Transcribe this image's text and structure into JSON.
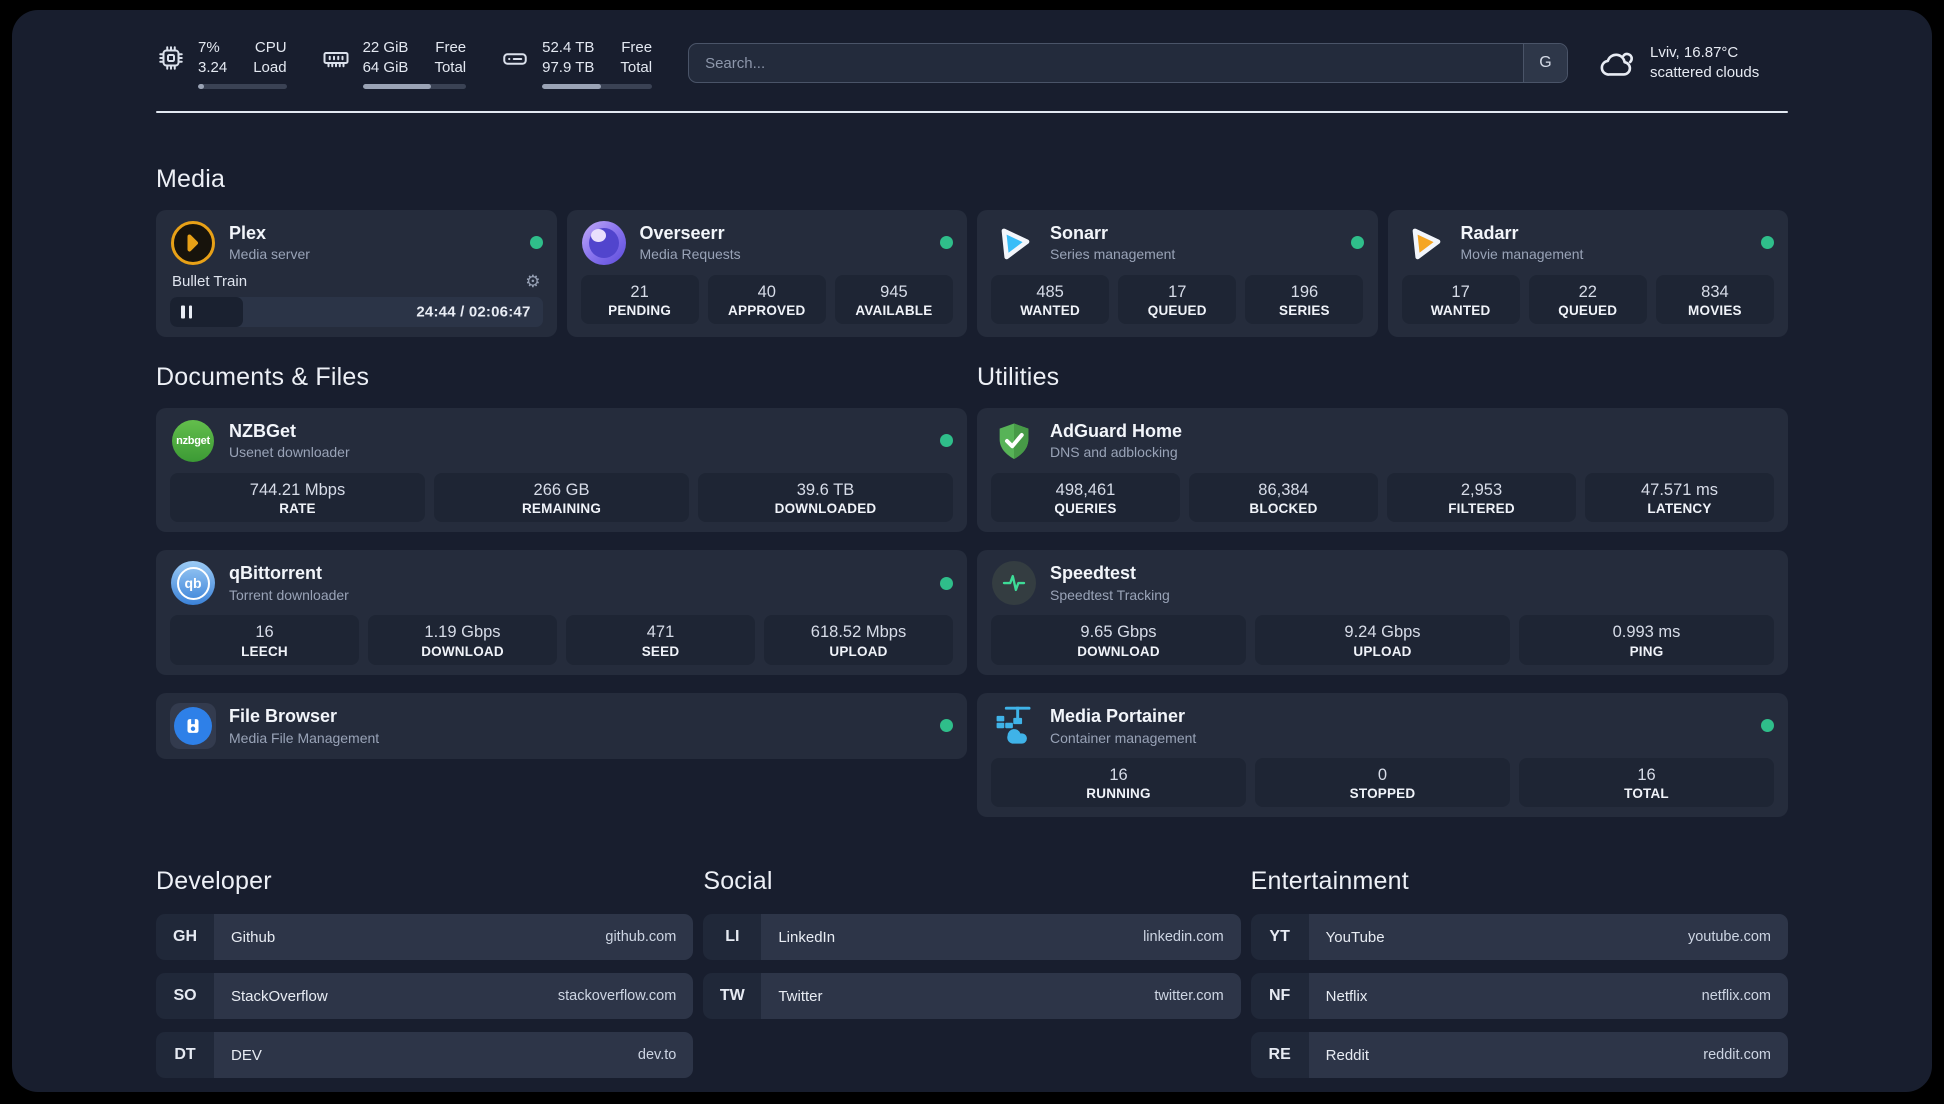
{
  "theme": {
    "background": "#181E2E",
    "card": "#252C3C",
    "tile": "#1E2534",
    "status_green": "#2FBE8A",
    "divider": "#E2E8F1"
  },
  "header": {
    "stats": [
      {
        "icon": "cpu-icon",
        "value_top": "7%",
        "value_bottom": "3.24",
        "label_top": "CPU",
        "label_bottom": "Load",
        "progress_pct": 7
      },
      {
        "icon": "ram-icon",
        "value_top": "22 GiB",
        "value_bottom": "64 GiB",
        "label_top": "Free",
        "label_bottom": "Total",
        "progress_pct": 66
      },
      {
        "icon": "disk-icon",
        "value_top": "52.4 TB",
        "value_bottom": "97.9 TB",
        "label_top": "Free",
        "label_bottom": "Total",
        "progress_pct": 54
      }
    ],
    "search": {
      "placeholder": "Search...",
      "engine_label": "G"
    },
    "weather": {
      "icon": "cloud-icon",
      "location_temp": "Lviv, 16.87°C",
      "condition": "scattered clouds"
    }
  },
  "media": {
    "heading": "Media",
    "plex": {
      "name": "Plex",
      "description": "Media server",
      "status": "online",
      "player": {
        "track": "Bullet Train",
        "time": "24:44 / 02:06:47",
        "progress_pct": 19.5
      }
    },
    "overseerr": {
      "name": "Overseerr",
      "description": "Media Requests",
      "status": "online",
      "stats": [
        {
          "value": "21",
          "label": "PENDING"
        },
        {
          "value": "40",
          "label": "APPROVED"
        },
        {
          "value": "945",
          "label": "AVAILABLE"
        }
      ]
    },
    "sonarr": {
      "name": "Sonarr",
      "description": "Series management",
      "status": "online",
      "stats": [
        {
          "value": "485",
          "label": "WANTED"
        },
        {
          "value": "17",
          "label": "QUEUED"
        },
        {
          "value": "196",
          "label": "SERIES"
        }
      ]
    },
    "radarr": {
      "name": "Radarr",
      "description": "Movie management",
      "status": "online",
      "stats": [
        {
          "value": "17",
          "label": "WANTED"
        },
        {
          "value": "22",
          "label": "QUEUED"
        },
        {
          "value": "834",
          "label": "MOVIES"
        }
      ]
    }
  },
  "documents": {
    "heading": "Documents & Files",
    "nzbget": {
      "name": "NZBGet",
      "description": "Usenet downloader",
      "icon_text": "nzbget",
      "status": "online",
      "stats": [
        {
          "value": "744.21 Mbps",
          "label": "RATE"
        },
        {
          "value": "266 GB",
          "label": "REMAINING"
        },
        {
          "value": "39.6 TB",
          "label": "DOWNLOADED"
        }
      ]
    },
    "qbittorrent": {
      "name": "qBittorrent",
      "description": "Torrent downloader",
      "icon_text": "qb",
      "status": "online",
      "stats": [
        {
          "value": "16",
          "label": "LEECH"
        },
        {
          "value": "1.19 Gbps",
          "label": "DOWNLOAD"
        },
        {
          "value": "471",
          "label": "SEED"
        },
        {
          "value": "618.52 Mbps",
          "label": "UPLOAD"
        }
      ]
    },
    "filebrowser": {
      "name": "File Browser",
      "description": "Media File Management",
      "status": "online"
    }
  },
  "utilities": {
    "heading": "Utilities",
    "adguard": {
      "name": "AdGuard Home",
      "description": "DNS and adblocking",
      "stats": [
        {
          "value": "498,461",
          "label": "QUERIES"
        },
        {
          "value": "86,384",
          "label": "BLOCKED"
        },
        {
          "value": "2,953",
          "label": "FILTERED"
        },
        {
          "value": "47.571 ms",
          "label": "LATENCY"
        }
      ]
    },
    "speedtest": {
      "name": "Speedtest",
      "description": "Speedtest Tracking",
      "stats": [
        {
          "value": "9.65 Gbps",
          "label": "DOWNLOAD"
        },
        {
          "value": "9.24 Gbps",
          "label": "UPLOAD"
        },
        {
          "value": "0.993 ms",
          "label": "PING"
        }
      ]
    },
    "portainer": {
      "name": "Media Portainer",
      "description": "Container management",
      "status": "online",
      "stats": [
        {
          "value": "16",
          "label": "RUNNING"
        },
        {
          "value": "0",
          "label": "STOPPED"
        },
        {
          "value": "16",
          "label": "TOTAL"
        }
      ]
    }
  },
  "links": {
    "developer": {
      "heading": "Developer",
      "items": [
        {
          "abbr": "GH",
          "name": "Github",
          "url": "github.com"
        },
        {
          "abbr": "SO",
          "name": "StackOverflow",
          "url": "stackoverflow.com"
        },
        {
          "abbr": "DT",
          "name": "DEV",
          "url": "dev.to"
        }
      ]
    },
    "social": {
      "heading": "Social",
      "items": [
        {
          "abbr": "LI",
          "name": "LinkedIn",
          "url": "linkedin.com"
        },
        {
          "abbr": "TW",
          "name": "Twitter",
          "url": "twitter.com"
        }
      ]
    },
    "entertainment": {
      "heading": "Entertainment",
      "items": [
        {
          "abbr": "YT",
          "name": "YouTube",
          "url": "youtube.com"
        },
        {
          "abbr": "NF",
          "name": "Netflix",
          "url": "netflix.com"
        },
        {
          "abbr": "RE",
          "name": "Reddit",
          "url": "reddit.com"
        }
      ]
    }
  }
}
